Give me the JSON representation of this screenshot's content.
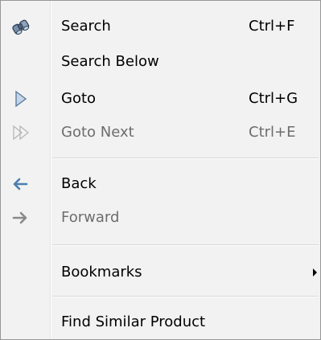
{
  "menu": {
    "items": [
      {
        "id": "search",
        "label": "Search",
        "shortcut": "Ctrl+F",
        "icon": "binoculars-icon",
        "enabled": true
      },
      {
        "id": "search-below",
        "label": "Search Below",
        "shortcut": "",
        "icon": "",
        "enabled": true
      },
      {
        "id": "goto",
        "label": "Goto",
        "shortcut": "Ctrl+G",
        "icon": "play-triangle-icon",
        "enabled": true
      },
      {
        "id": "goto-next",
        "label": "Goto Next",
        "shortcut": "Ctrl+E",
        "icon": "double-triangle-icon",
        "enabled": false
      },
      {
        "id": "back",
        "label": "Back",
        "shortcut": "",
        "icon": "arrow-left-icon",
        "enabled": true
      },
      {
        "id": "forward",
        "label": "Forward",
        "shortcut": "",
        "icon": "arrow-right-icon",
        "enabled": false
      },
      {
        "id": "bookmarks",
        "label": "Bookmarks",
        "shortcut": "",
        "icon": "",
        "enabled": true,
        "submenu": true
      },
      {
        "id": "find-similar",
        "label": "Find Similar Product",
        "shortcut": "",
        "icon": "",
        "enabled": true
      }
    ]
  },
  "colors": {
    "background": "#f2f2f2",
    "border": "#979797",
    "text": "#000000",
    "disabled_text": "#6d6d6d",
    "icon_blue": "#4a7fb0"
  }
}
